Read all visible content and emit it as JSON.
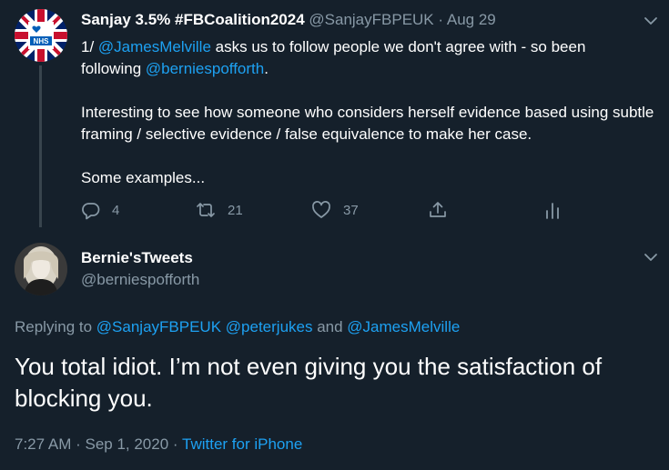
{
  "colors": {
    "background": "#15202b",
    "text_primary": "#ffffff",
    "text_secondary": "#8899a6",
    "accent": "#1da1f2",
    "divider": "#38444d"
  },
  "tweet1": {
    "name": "Sanjay 3.5% #FBCoalition2024",
    "handle": "@SanjayFBPEUK",
    "separator": "·",
    "date": "Aug 29",
    "avatar_text": "NHS",
    "line1_prefix": "1/ ",
    "line1_mention": "@JamesMelville",
    "line1_suffix": " asks us to follow people we don't agree with - so been",
    "line2_prefix": "following ",
    "line2_mention": "@berniespofforth",
    "line2_suffix": ".",
    "paragraph2": "Interesting to see how someone who considers herself evidence based using subtle framing / selective evidence / false equivalence to make her case.",
    "paragraph3": "Some examples...",
    "actions": {
      "reply_icon": "reply-icon",
      "reply_count": "4",
      "retweet_icon": "retweet-icon",
      "retweet_count": "21",
      "like_icon": "heart-icon",
      "like_count": "37",
      "share_icon": "share-icon",
      "analytics_icon": "analytics-icon"
    }
  },
  "tweet2": {
    "name": "Bernie'sTweets",
    "handle": "@berniespofforth",
    "replying_label": "Replying to ",
    "replying_mention1": "@SanjayFBPEUK",
    "replying_mention2": "@peterjukes",
    "replying_and": " and ",
    "replying_mention3": "@JamesMelville",
    "text": "You total idiot. I’m not even giving you the satisfaction of blocking you.",
    "time": "7:27 AM",
    "date": "Sep 1, 2020",
    "separator": " · ",
    "source": "Twitter for iPhone"
  }
}
